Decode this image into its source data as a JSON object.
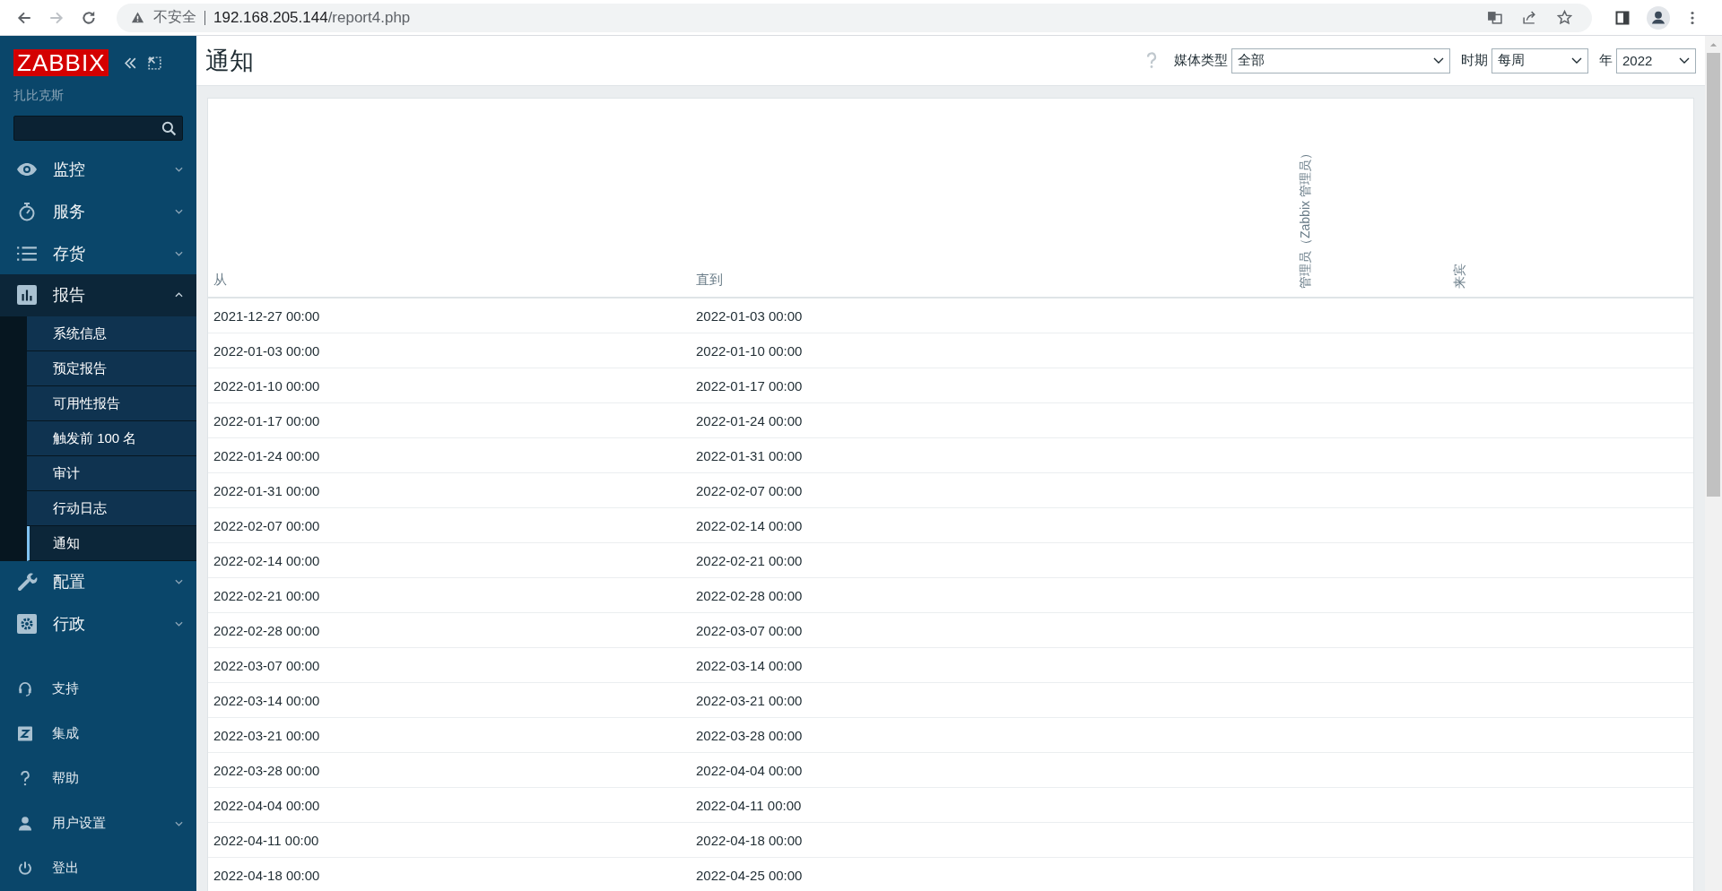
{
  "browser": {
    "security_label": "不安全",
    "url_host": "192.168.205.144",
    "url_path": "/report4.php"
  },
  "sidebar": {
    "logo": "ZABBIX",
    "server_name": "扎比克斯",
    "menu": [
      {
        "label": "监控",
        "expanded": false
      },
      {
        "label": "服务",
        "expanded": false
      },
      {
        "label": "存货",
        "expanded": false
      },
      {
        "label": "报告",
        "expanded": true,
        "children": [
          {
            "label": "系统信息",
            "selected": false
          },
          {
            "label": "预定报告",
            "selected": false
          },
          {
            "label": "可用性报告",
            "selected": false
          },
          {
            "label": "触发前 100 名",
            "selected": false
          },
          {
            "label": "审计",
            "selected": false
          },
          {
            "label": "行动日志",
            "selected": false
          },
          {
            "label": "通知",
            "selected": true
          }
        ]
      },
      {
        "label": "配置",
        "expanded": false
      },
      {
        "label": "行政",
        "expanded": false
      }
    ],
    "user_menu": [
      {
        "label": "支持"
      },
      {
        "label": "集成"
      },
      {
        "label": "帮助"
      },
      {
        "label": "用户设置",
        "expanded": false
      },
      {
        "label": "登出"
      }
    ]
  },
  "header": {
    "title": "通知",
    "filters": [
      {
        "label": "媒体类型",
        "value": "全部"
      },
      {
        "label": "时期",
        "value": "每周"
      },
      {
        "label": "年",
        "value": "2022"
      }
    ]
  },
  "table": {
    "columns": [
      "从",
      "直到",
      "管理员（Zabbix 管理员）",
      "来宾"
    ],
    "rows": [
      [
        "2021-12-27 00:00",
        "2022-01-03 00:00"
      ],
      [
        "2022-01-03 00:00",
        "2022-01-10 00:00"
      ],
      [
        "2022-01-10 00:00",
        "2022-01-17 00:00"
      ],
      [
        "2022-01-17 00:00",
        "2022-01-24 00:00"
      ],
      [
        "2022-01-24 00:00",
        "2022-01-31 00:00"
      ],
      [
        "2022-01-31 00:00",
        "2022-02-07 00:00"
      ],
      [
        "2022-02-07 00:00",
        "2022-02-14 00:00"
      ],
      [
        "2022-02-14 00:00",
        "2022-02-21 00:00"
      ],
      [
        "2022-02-21 00:00",
        "2022-02-28 00:00"
      ],
      [
        "2022-02-28 00:00",
        "2022-03-07 00:00"
      ],
      [
        "2022-03-07 00:00",
        "2022-03-14 00:00"
      ],
      [
        "2022-03-14 00:00",
        "2022-03-21 00:00"
      ],
      [
        "2022-03-21 00:00",
        "2022-03-28 00:00"
      ],
      [
        "2022-03-28 00:00",
        "2022-04-04 00:00"
      ],
      [
        "2022-04-04 00:00",
        "2022-04-11 00:00"
      ],
      [
        "2022-04-11 00:00",
        "2022-04-18 00:00"
      ],
      [
        "2022-04-18 00:00",
        "2022-04-25 00:00"
      ]
    ]
  }
}
